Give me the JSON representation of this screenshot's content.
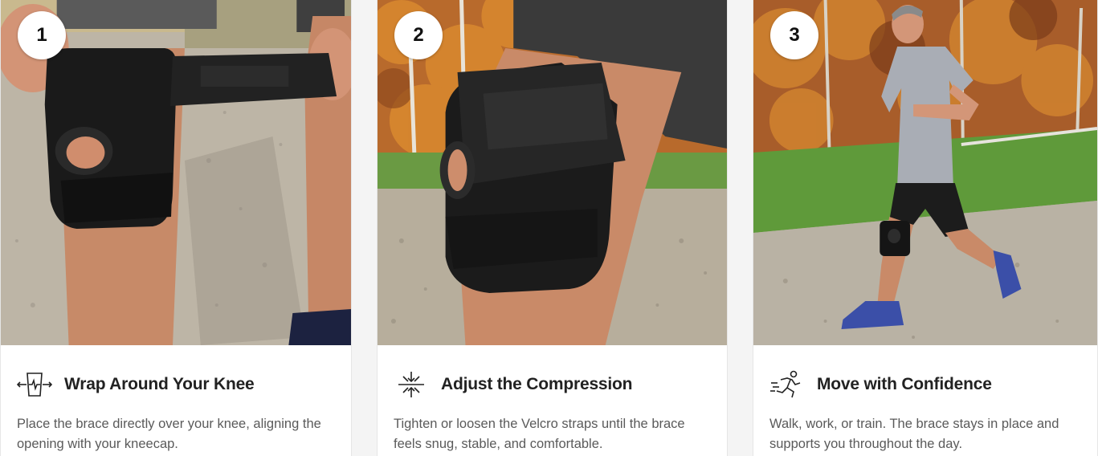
{
  "steps": [
    {
      "number": "1",
      "icon": "knee-wrap-icon",
      "title": "Wrap Around Your Knee",
      "description": "Place the brace directly over your knee, aligning the opening with your kneecap."
    },
    {
      "number": "2",
      "icon": "compression-arrows-icon",
      "title": "Adjust the Compression",
      "description": "Tighten or loosen the Velcro straps until the brace feels snug, stable, and comfortable."
    },
    {
      "number": "3",
      "icon": "running-person-icon",
      "title": "Move with Confidence",
      "description": "Walk, work, or train. The brace stays in place and supports you throughout the day."
    }
  ],
  "colors": {
    "brace": "#1a1a1a",
    "gravel": "#b9b2a4",
    "grass": "#5f9a3a",
    "autumn_foliage": "#c8732c",
    "skin": "#c78a68",
    "text_heading": "#222222",
    "text_body": "#5a5a5a"
  }
}
